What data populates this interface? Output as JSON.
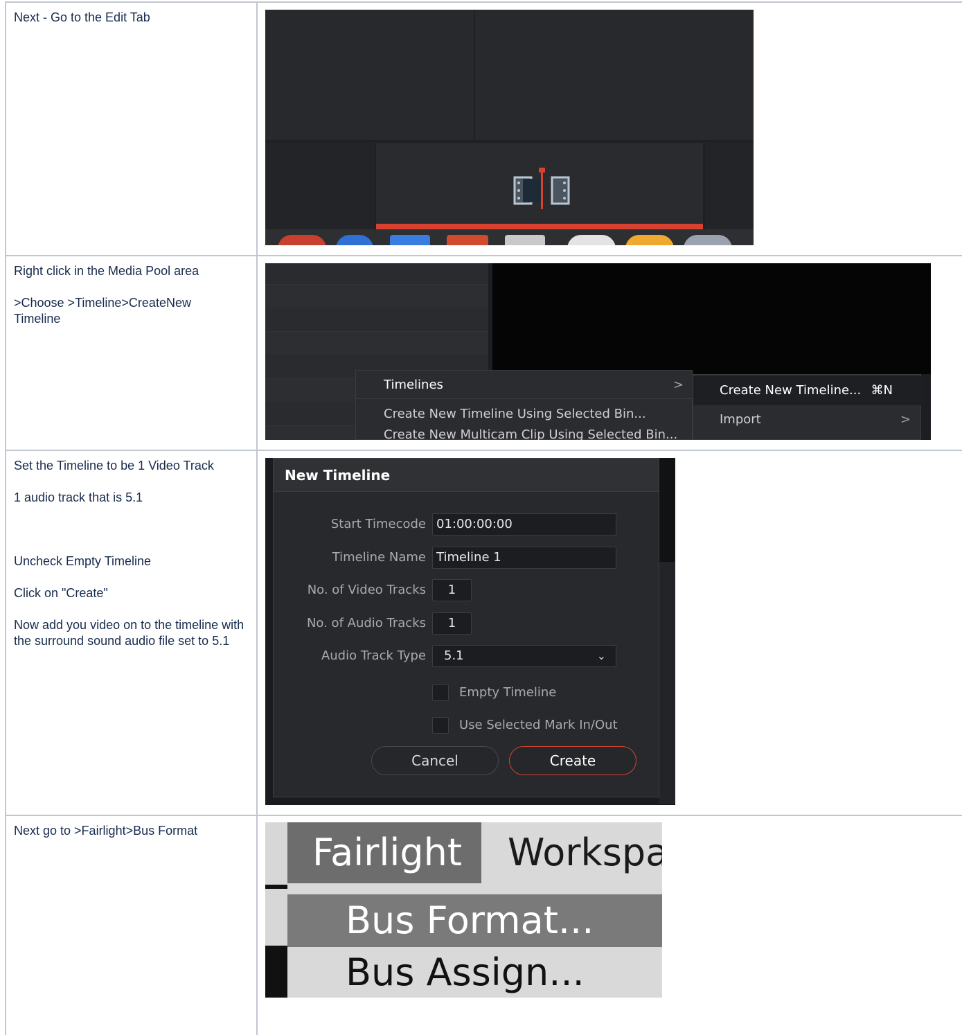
{
  "rows": [
    {
      "instructions": [
        "Next - Go to the Edit Tab"
      ],
      "screenshot": {
        "icon": "edit-page-icon",
        "accent": "#d8412f"
      }
    },
    {
      "instructions": [
        "Right click in the Media Pool area",
        ">Choose >Timeline>CreateNew Timeline"
      ],
      "screenshot": {
        "menu_items": [
          "Timelines",
          "Create New Timeline Using Selected Bin...",
          "Create New Multicam Clip Using Selected Bin..."
        ],
        "submenu_items": [
          "Create New Timeline...",
          "Import"
        ],
        "shortcut": "⌘N",
        "arrow": ">"
      }
    },
    {
      "instructions": [
        "Set the Timeline to be 1 Video Track",
        "1 audio track that is 5.1",
        "",
        "Uncheck Empty Timeline",
        "Click on \"Create\"",
        "Now add you video on to the timeline with the surround sound audio file set to 5.1"
      ],
      "screenshot": {
        "title": "New Timeline",
        "fields": {
          "start_timecode_label": "Start Timecode",
          "start_timecode_value": "01:00:00:00",
          "timeline_name_label": "Timeline Name",
          "timeline_name_value": "Timeline 1",
          "video_tracks_label": "No. of Video Tracks",
          "video_tracks_value": "1",
          "audio_tracks_label": "No. of Audio Tracks",
          "audio_tracks_value": "1",
          "audio_type_label": "Audio Track Type",
          "audio_type_value": "5.1"
        },
        "checkboxes": [
          "Empty Timeline",
          "Use Selected Mark In/Out"
        ],
        "cancel_label": "Cancel",
        "create_label": "Create",
        "accent": "#d8412f"
      }
    },
    {
      "instructions": [
        "Next go to >Fairlight>Bus Format"
      ],
      "screenshot": {
        "menubar": [
          "Fairlight",
          "Workspa"
        ],
        "items": [
          "Bus Format...",
          "Bus Assign..."
        ]
      }
    }
  ]
}
